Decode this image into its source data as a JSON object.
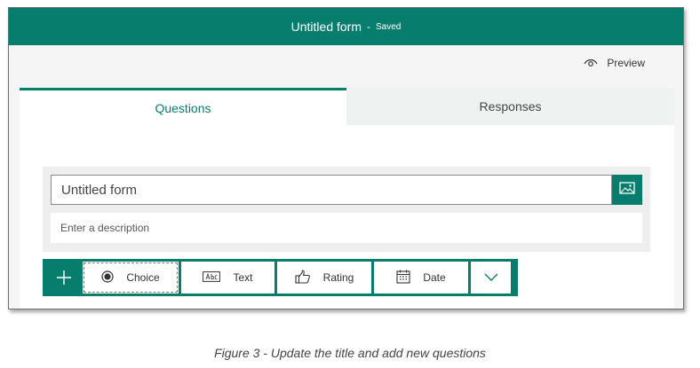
{
  "app": {
    "title": "Untitled form",
    "separator": "-",
    "save_status": "Saved"
  },
  "header": {
    "preview_label": "Preview",
    "preview_icon": "eye-icon"
  },
  "tabs": [
    {
      "label": "Questions",
      "active": true
    },
    {
      "label": "Responses",
      "active": false
    }
  ],
  "form": {
    "title_value": "Untitled form",
    "description_placeholder": "Enter a description",
    "image_icon": "image-icon"
  },
  "toolbar": {
    "add_icon": "plus-icon",
    "buttons": [
      {
        "label": "Choice",
        "icon": "radio-icon"
      },
      {
        "label": "Text",
        "icon": "text-box-icon"
      },
      {
        "label": "Rating",
        "icon": "thumbs-up-icon"
      },
      {
        "label": "Date",
        "icon": "calendar-icon"
      }
    ],
    "more_icon": "chevron-down-icon"
  },
  "caption": "Figure 3 - Update the title and add new questions",
  "colors": {
    "brand": "#077d6e",
    "tab_inactive_bg": "#eef3f2",
    "card_bg": "#eeeeee"
  }
}
